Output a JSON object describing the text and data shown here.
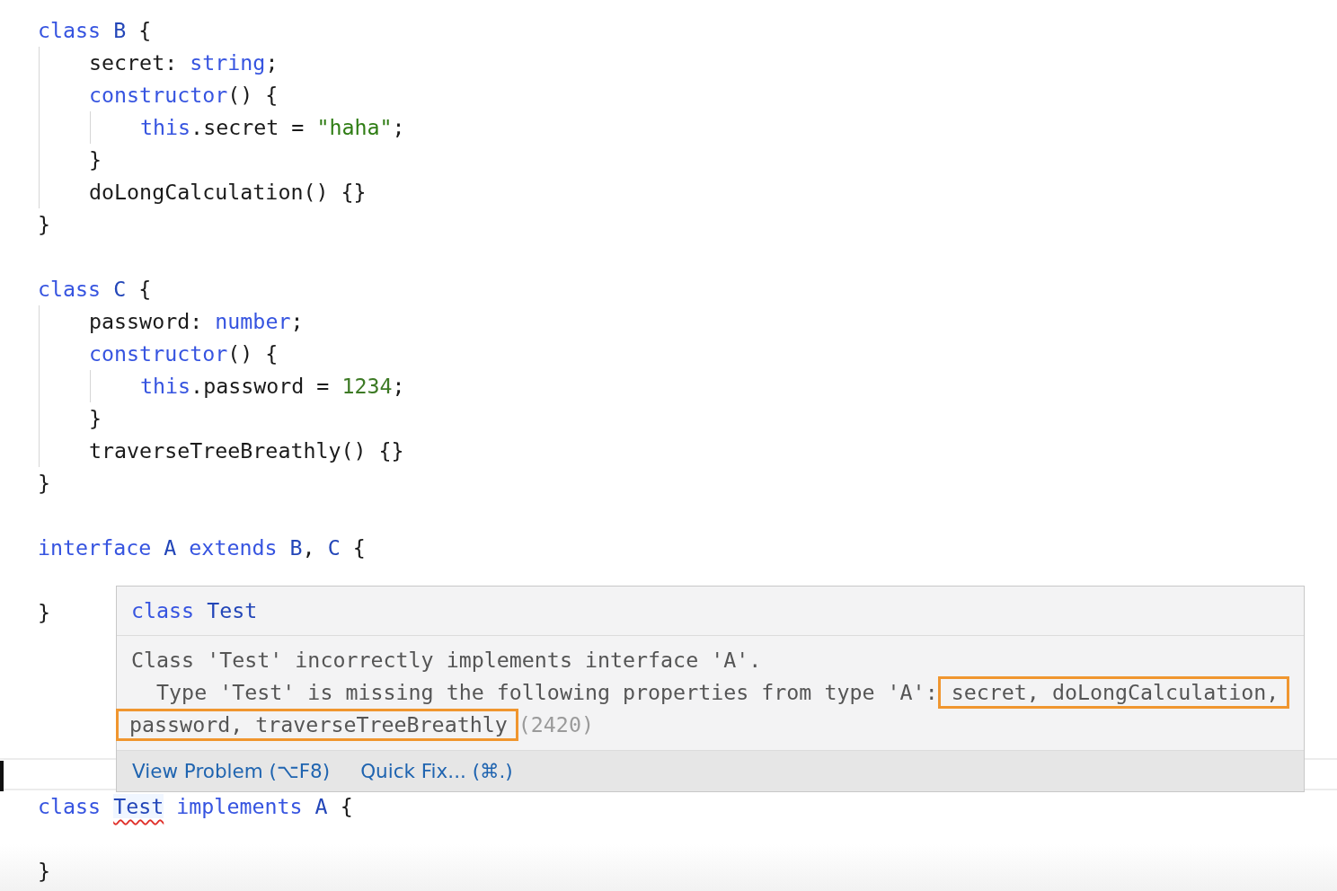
{
  "editor": {
    "lines": [
      {
        "kind": "code",
        "tokens": [
          {
            "text": "class ",
            "kind": "keyword"
          },
          {
            "text": "B",
            "kind": "type"
          },
          {
            "text": " {",
            "kind": "plain"
          }
        ],
        "children": [
          {
            "kind": "code",
            "tokens": [
              {
                "text": "secret",
                "kind": "plain"
              },
              {
                "text": ": ",
                "kind": "plain"
              },
              {
                "text": "string",
                "kind": "keyword"
              },
              {
                "text": ";",
                "kind": "plain"
              }
            ]
          },
          {
            "kind": "code",
            "tokens": [
              {
                "text": "constructor",
                "kind": "keyword"
              },
              {
                "text": "() {",
                "kind": "plain"
              }
            ],
            "children": [
              {
                "kind": "code",
                "tokens": [
                  {
                    "text": "this",
                    "kind": "keyword"
                  },
                  {
                    "text": ".secret = ",
                    "kind": "plain"
                  },
                  {
                    "text": "\"haha\"",
                    "kind": "string"
                  },
                  {
                    "text": ";",
                    "kind": "plain"
                  }
                ]
              }
            ]
          },
          {
            "kind": "code",
            "tokens": [
              {
                "text": "}",
                "kind": "plain"
              }
            ]
          },
          {
            "kind": "code",
            "tokens": [
              {
                "text": "doLongCalculation() {}",
                "kind": "plain"
              }
            ]
          }
        ]
      },
      {
        "kind": "code",
        "tokens": [
          {
            "text": "}",
            "kind": "plain"
          }
        ]
      },
      {
        "kind": "blank"
      },
      {
        "kind": "code",
        "tokens": [
          {
            "text": "class ",
            "kind": "keyword"
          },
          {
            "text": "C",
            "kind": "type"
          },
          {
            "text": " {",
            "kind": "plain"
          }
        ],
        "children": [
          {
            "kind": "code",
            "tokens": [
              {
                "text": "password",
                "kind": "plain"
              },
              {
                "text": ": ",
                "kind": "plain"
              },
              {
                "text": "number",
                "kind": "keyword"
              },
              {
                "text": ";",
                "kind": "plain"
              }
            ]
          },
          {
            "kind": "code",
            "tokens": [
              {
                "text": "constructor",
                "kind": "keyword"
              },
              {
                "text": "() {",
                "kind": "plain"
              }
            ],
            "children": [
              {
                "kind": "code",
                "tokens": [
                  {
                    "text": "this",
                    "kind": "keyword"
                  },
                  {
                    "text": ".password = ",
                    "kind": "plain"
                  },
                  {
                    "text": "1234",
                    "kind": "number"
                  },
                  {
                    "text": ";",
                    "kind": "plain"
                  }
                ]
              }
            ]
          },
          {
            "kind": "code",
            "tokens": [
              {
                "text": "}",
                "kind": "plain"
              }
            ]
          },
          {
            "kind": "code",
            "tokens": [
              {
                "text": "traverseTreeBreathly() {}",
                "kind": "plain"
              }
            ]
          }
        ]
      },
      {
        "kind": "code",
        "tokens": [
          {
            "text": "}",
            "kind": "plain"
          }
        ]
      },
      {
        "kind": "blank"
      },
      {
        "kind": "code",
        "tokens": [
          {
            "text": "interface ",
            "kind": "keyword"
          },
          {
            "text": "A ",
            "kind": "type"
          },
          {
            "text": "extends ",
            "kind": "keyword"
          },
          {
            "text": "B",
            "kind": "type"
          },
          {
            "text": ", ",
            "kind": "plain"
          },
          {
            "text": "C",
            "kind": "type"
          },
          {
            "text": " {",
            "kind": "plain"
          }
        ]
      },
      {
        "kind": "blank"
      },
      {
        "kind": "code",
        "tokens": [
          {
            "text": "}",
            "kind": "plain"
          }
        ]
      },
      {
        "kind": "blank"
      },
      {
        "kind": "blank"
      },
      {
        "kind": "blank"
      },
      {
        "kind": "blank"
      },
      {
        "kind": "cursor"
      },
      {
        "kind": "code",
        "tokens": [
          {
            "text": "class ",
            "kind": "keyword"
          },
          {
            "text": "Test",
            "kind": "type",
            "error": true
          },
          {
            "text": " implements ",
            "kind": "keyword"
          },
          {
            "text": "A",
            "kind": "type"
          },
          {
            "text": " {",
            "kind": "plain"
          }
        ]
      },
      {
        "kind": "blank"
      },
      {
        "kind": "code",
        "tokens": [
          {
            "text": "}",
            "kind": "plain"
          }
        ]
      }
    ]
  },
  "hover": {
    "title": [
      {
        "text": "class ",
        "kind": "keyword"
      },
      {
        "text": "Test",
        "kind": "type"
      }
    ],
    "message": [
      [
        {
          "text": "Class 'Test' incorrectly implements interface 'A'.",
          "kind": "plain"
        }
      ],
      [
        {
          "text": "  Type 'Test' is missing the following properties from type 'A':",
          "kind": "plain"
        },
        {
          "text": "secret, doLongCalculation,",
          "kind": "highlight"
        }
      ],
      [
        {
          "text": "password, traverseTreeBreathly",
          "kind": "highlight"
        },
        {
          "text": "(2420)",
          "kind": "code"
        }
      ]
    ],
    "actions": [
      "View Problem (⌥F8)",
      "Quick Fix... (⌘.)"
    ]
  }
}
